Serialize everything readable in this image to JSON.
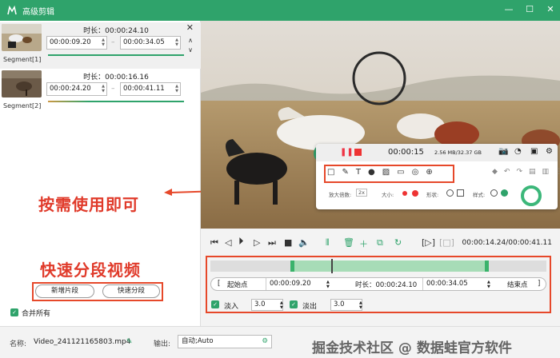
{
  "window": {
    "title": "高级剪辑"
  },
  "segments": [
    {
      "label": "Segment[1]",
      "duration_label": "时长：00:00:24.10",
      "start": "00:00:09.20",
      "end": "00:00:34.05"
    },
    {
      "label": "Segment[2]",
      "duration_label": "时长：00:00:16.16",
      "start": "00:00:24.20",
      "end": "00:00:41.11"
    }
  ],
  "annotations": {
    "top": "按需使用即可",
    "bottom": "快速分段视频"
  },
  "buttons": {
    "add_segment": "新增片段",
    "quick_split": "快速分段"
  },
  "merge_all": "合并所有",
  "bottom": {
    "name_label": "名称:",
    "file_name": "Video_241121165803.mp4",
    "output_label": "输出:",
    "output_value": "自动;Auto",
    "watermark": "掘金技术社区 @ 数据蛙官方软件"
  },
  "recorder": {
    "time": "00:00:15",
    "size": "2.56 MB/32.37 GB",
    "labels": {
      "zoom": "放大倍数:",
      "zoom_value": "2x",
      "size": "大小:",
      "shape": "形状:",
      "style": "样式:"
    }
  },
  "playback": {
    "timecode": "00:00:14.24/00:00:41.11"
  },
  "clip": {
    "start_label": "起始点",
    "start_value": "00:00:09.20",
    "duration_label": "时长：00:00:24.10",
    "end_value": "00:00:34.05",
    "end_label": "结束点",
    "fade_in_label": "淡入",
    "fade_in_value": "3.0",
    "fade_out_label": "淡出",
    "fade_out_value": "3.0"
  }
}
